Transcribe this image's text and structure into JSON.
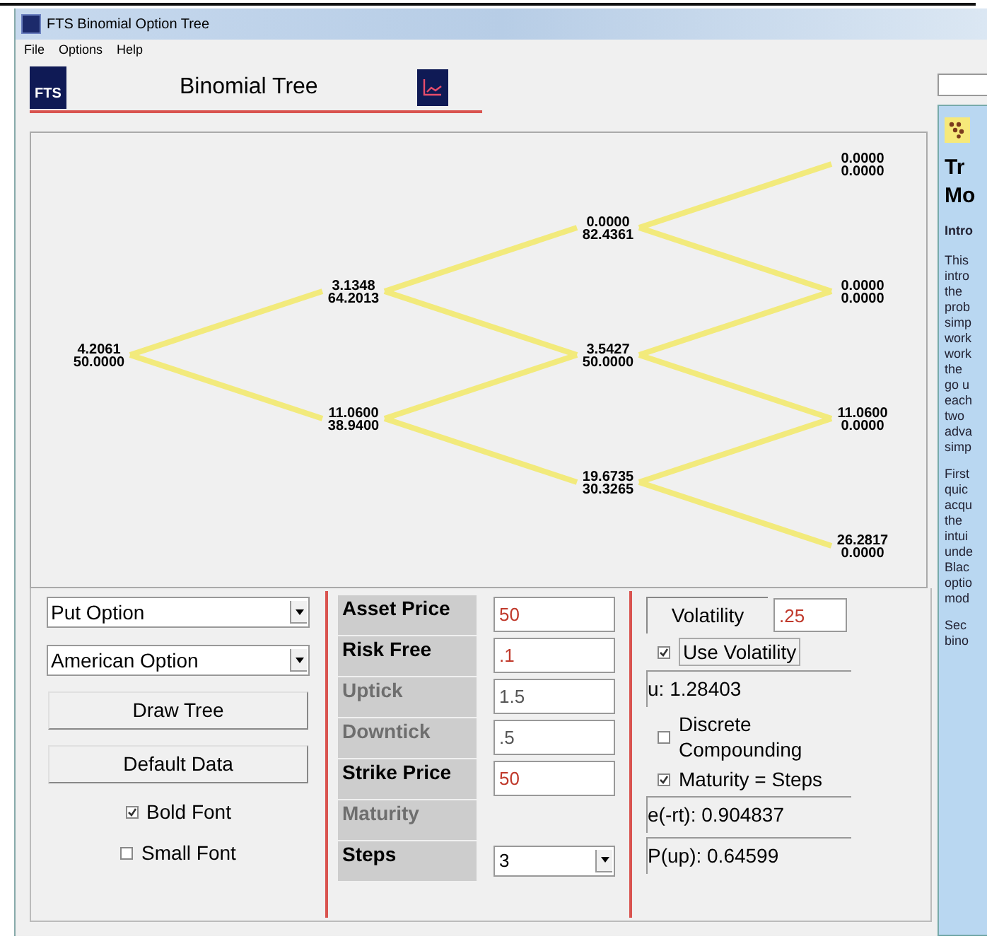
{
  "window": {
    "title": "FTS Binomial Option Tree"
  },
  "menu": [
    {
      "label": "File"
    },
    {
      "label": "Options"
    },
    {
      "label": "Help"
    }
  ],
  "header": {
    "logo": "FTS",
    "title": "Binomial Tree"
  },
  "tree": {
    "steps": [
      [
        {
          "value": "4.2061",
          "price": "50.0000"
        }
      ],
      [
        {
          "value": "3.1348",
          "price": "64.2013"
        },
        {
          "value": "11.0600",
          "price": "38.9400"
        }
      ],
      [
        {
          "value": "0.0000",
          "price": "82.4361"
        },
        {
          "value": "3.5427",
          "price": "50.0000"
        },
        {
          "value": "19.6735",
          "price": "30.3265"
        }
      ],
      [
        {
          "value": "0.0000",
          "price": "0.0000"
        },
        {
          "value": "0.0000",
          "price": "0.0000"
        },
        {
          "value": "11.0600",
          "price": "0.0000"
        },
        {
          "value": "26.2817",
          "price": "0.0000"
        }
      ]
    ]
  },
  "controls": {
    "selects": [
      {
        "value": "Put Option"
      },
      {
        "value": "American Option"
      }
    ],
    "buttons": [
      {
        "label": "Draw Tree"
      },
      {
        "label": "Default Data"
      }
    ],
    "checkboxes": [
      {
        "label": "Bold Font",
        "checked": true
      },
      {
        "label": "Small Font",
        "checked": false
      }
    ]
  },
  "parameters": [
    {
      "label": "Asset Price",
      "kind": "input",
      "value": "50",
      "disabled": false
    },
    {
      "label": "Risk Free",
      "kind": "input",
      "value": ".1",
      "disabled": false
    },
    {
      "label": "Uptick",
      "kind": "input",
      "value": "1.5",
      "disabled": true
    },
    {
      "label": "Downtick",
      "kind": "input",
      "value": ".5",
      "disabled": true
    },
    {
      "label": "Strike Price",
      "kind": "input",
      "value": "50",
      "disabled": false
    },
    {
      "label": "Maturity",
      "kind": "none",
      "disabled": true
    },
    {
      "label": "Steps",
      "kind": "select",
      "value": "3",
      "disabled": false
    }
  ],
  "volatility": {
    "label": "Volatility",
    "value": ".25"
  },
  "results": [
    {
      "kind": "checkbox",
      "label": "Use Volatility",
      "checked": true
    },
    {
      "kind": "readout",
      "text": "u: 1.28403"
    },
    {
      "kind": "checkbox",
      "label": "Discrete Compounding",
      "checked": false
    },
    {
      "kind": "checkbox",
      "label": "Maturity = Steps",
      "checked": true
    },
    {
      "kind": "readout",
      "text": "e(-rt): 0.904837"
    },
    {
      "kind": "readout",
      "text": "P(up): 0.64599"
    }
  ],
  "help": [
    {
      "kind": "heading",
      "lines": [
        "Tr",
        "Mo"
      ]
    },
    {
      "kind": "subheading",
      "lines": [
        "Intro"
      ]
    },
    {
      "kind": "paragraph",
      "lines": [
        "This",
        "intro",
        "the",
        "prob",
        "simp",
        "work",
        "work",
        "the",
        "go u",
        "each",
        "two",
        "adva",
        "simp"
      ]
    },
    {
      "kind": "paragraph",
      "lines": [
        "First",
        "quic",
        "acqu",
        "the",
        "intui",
        "unde",
        "Blac",
        "optio",
        "mod"
      ]
    },
    {
      "kind": "paragraph",
      "lines": [
        "Sec",
        "bino"
      ]
    }
  ]
}
